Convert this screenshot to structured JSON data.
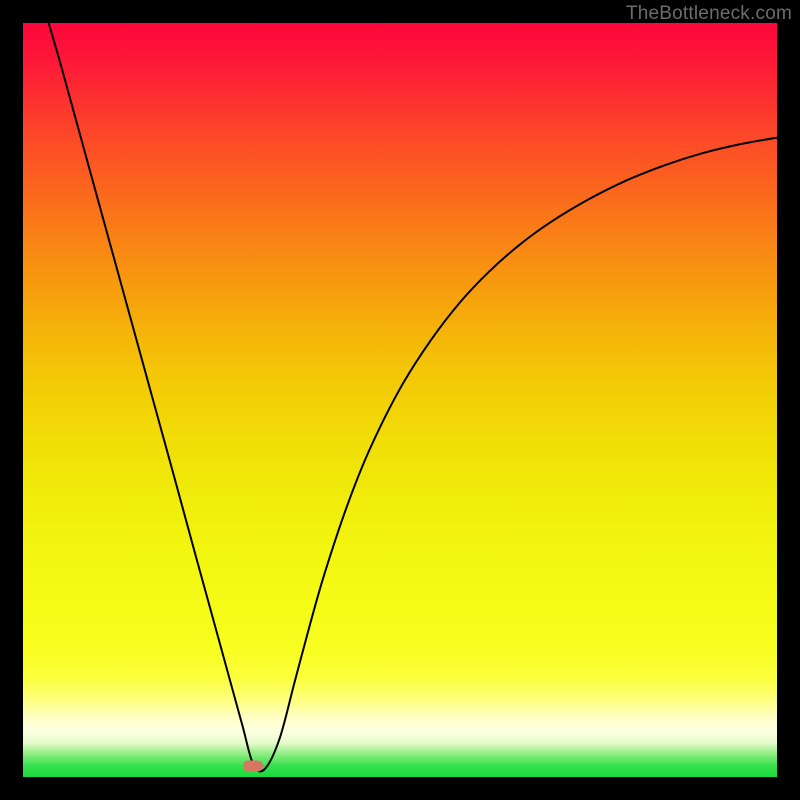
{
  "watermark": "TheBottleneck.com",
  "colors": {
    "frame_bg": "#000000",
    "curve_stroke": "#000000",
    "marker_fill": "#d57763"
  },
  "chart_data": {
    "type": "line",
    "title": "",
    "xlabel": "",
    "ylabel": "",
    "xlim": [
      0,
      100
    ],
    "ylim": [
      0,
      100
    ],
    "grid": false,
    "legend": false,
    "series": [
      {
        "name": "bottleneck-curve",
        "x": [
          3.4,
          5,
          8,
          11,
          14,
          17,
          20,
          23,
          26,
          29,
          30.5,
          32,
          34,
          36,
          38,
          40,
          43,
          46,
          50,
          54,
          58,
          62,
          66,
          70,
          75,
          80,
          85,
          90,
          95,
          100
        ],
        "y": [
          100,
          94.5,
          83.6,
          72.7,
          61.8,
          50.9,
          40.0,
          29.0,
          18.1,
          7.2,
          1.8,
          1.0,
          5.0,
          12.5,
          20.0,
          27.0,
          36.0,
          43.5,
          51.5,
          57.8,
          63.0,
          67.2,
          70.7,
          73.6,
          76.6,
          79.1,
          81.1,
          82.7,
          83.9,
          84.8
        ]
      }
    ],
    "marker": {
      "x": 30.5,
      "y": 1.4
    }
  }
}
